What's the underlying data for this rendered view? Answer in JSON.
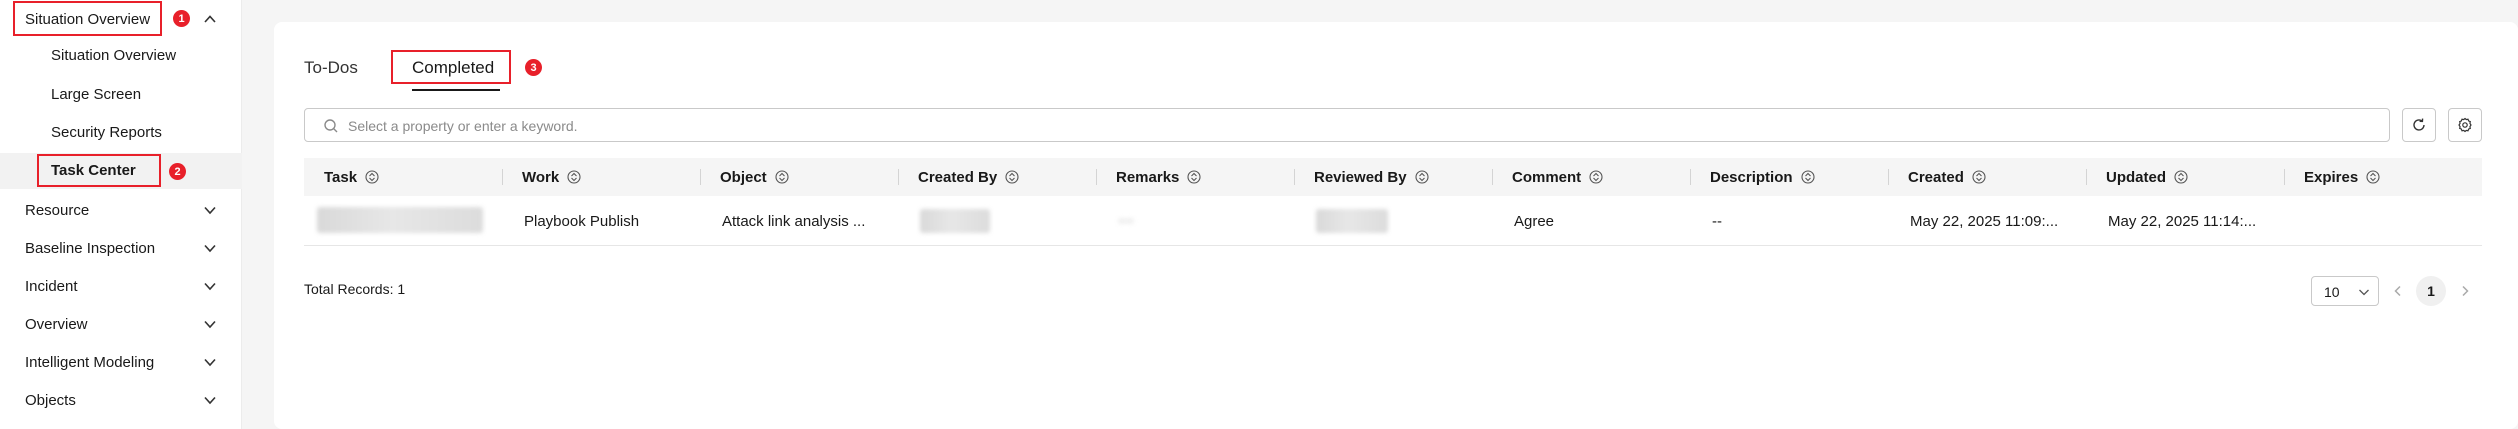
{
  "sidebar": {
    "group": {
      "label": "Situation Overview",
      "badge": "1"
    },
    "sub_items": [
      {
        "label": "Situation Overview"
      },
      {
        "label": "Large Screen"
      },
      {
        "label": "Security Reports"
      },
      {
        "label": "Task Center",
        "badge": "2",
        "active": true
      }
    ],
    "items": [
      {
        "label": "Resource"
      },
      {
        "label": "Baseline Inspection"
      },
      {
        "label": "Incident"
      },
      {
        "label": "Overview"
      },
      {
        "label": "Intelligent Modeling"
      },
      {
        "label": "Objects"
      }
    ]
  },
  "tabs": [
    {
      "label": "To-Dos"
    },
    {
      "label": "Completed",
      "badge": "3",
      "active": true
    }
  ],
  "search": {
    "placeholder": "Select a property or enter a keyword."
  },
  "table": {
    "columns": [
      "Task",
      "Work",
      "Object",
      "Created By",
      "Remarks",
      "Reviewed By",
      "Comment",
      "Description",
      "Created",
      "Updated",
      "Expires"
    ],
    "rows": [
      {
        "work": "Playbook Publish",
        "object": "Attack link analysis ...",
        "comment": "Agree",
        "description": "--",
        "created": "May 22, 2025 11:09:...",
        "updated": "May 22, 2025 11:14:...",
        "expires": ""
      }
    ]
  },
  "footer": {
    "total": "Total Records: 1",
    "page_size": "10",
    "current_page": "1"
  },
  "colors": {
    "highlight": "#e8202a",
    "text": "#191919"
  },
  "icons": [
    "chevron-up-icon",
    "chevron-down-icon",
    "search-icon",
    "refresh-icon",
    "gear-icon",
    "sort-icon",
    "chevron-left-icon",
    "chevron-right-icon"
  ]
}
